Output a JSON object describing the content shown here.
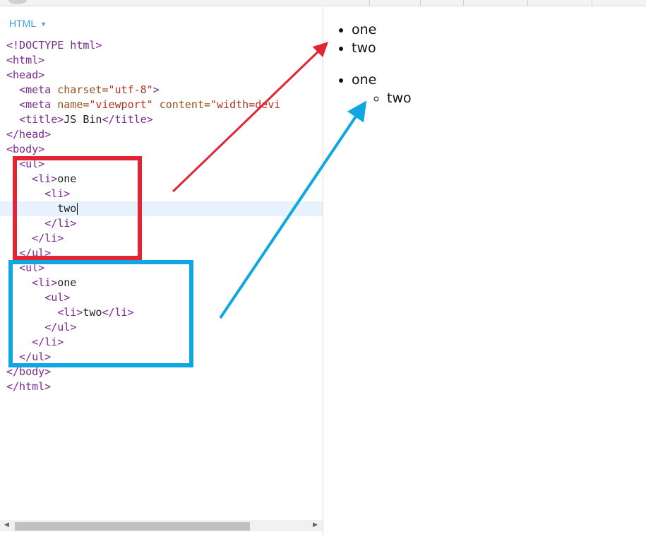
{
  "editor": {
    "language_label": "HTML",
    "code_lines": [
      {
        "indent": "",
        "parts": [
          {
            "c": "kw",
            "t": "<!DOCTYPE html>"
          }
        ]
      },
      {
        "indent": "",
        "parts": [
          {
            "c": "tag",
            "t": "<html>"
          }
        ]
      },
      {
        "indent": "",
        "parts": [
          {
            "c": "tag",
            "t": "<head>"
          }
        ]
      },
      {
        "indent": "  ",
        "parts": [
          {
            "c": "tag",
            "t": "<meta "
          },
          {
            "c": "attr",
            "t": "charset="
          },
          {
            "c": "str",
            "t": "\"utf-8\""
          },
          {
            "c": "tag",
            "t": ">"
          }
        ]
      },
      {
        "indent": "  ",
        "parts": [
          {
            "c": "tag",
            "t": "<meta "
          },
          {
            "c": "attr",
            "t": "name="
          },
          {
            "c": "str",
            "t": "\"viewport\""
          },
          {
            "c": "attr",
            "t": " content="
          },
          {
            "c": "str",
            "t": "\"width=devi"
          }
        ]
      },
      {
        "indent": "  ",
        "parts": [
          {
            "c": "tag",
            "t": "<title>"
          },
          {
            "c": "txt",
            "t": "JS Bin"
          },
          {
            "c": "tag",
            "t": "</title>"
          }
        ]
      },
      {
        "indent": "",
        "parts": [
          {
            "c": "tag",
            "t": "</head>"
          }
        ]
      },
      {
        "indent": "",
        "parts": [
          {
            "c": "tag",
            "t": "<body>"
          }
        ]
      },
      {
        "indent": "  ",
        "parts": [
          {
            "c": "tag",
            "t": "<ul>"
          }
        ]
      },
      {
        "indent": "    ",
        "parts": [
          {
            "c": "tag",
            "t": "<li>"
          },
          {
            "c": "txt",
            "t": "one"
          }
        ]
      },
      {
        "indent": "      ",
        "parts": [
          {
            "c": "tag",
            "t": "<li>"
          }
        ]
      },
      {
        "indent": "        ",
        "parts": [
          {
            "c": "txt",
            "t": "two"
          }
        ],
        "active": true,
        "cursor": true
      },
      {
        "indent": "      ",
        "parts": [
          {
            "c": "tag",
            "t": "</li>"
          }
        ]
      },
      {
        "indent": "    ",
        "parts": [
          {
            "c": "tag",
            "t": "</li>"
          }
        ]
      },
      {
        "indent": "  ",
        "parts": [
          {
            "c": "tag",
            "t": "</ul>"
          }
        ]
      },
      {
        "indent": "  ",
        "parts": [
          {
            "c": "tag",
            "t": "<ul>"
          }
        ]
      },
      {
        "indent": "    ",
        "parts": [
          {
            "c": "tag",
            "t": "<li>"
          },
          {
            "c": "txt",
            "t": "one"
          }
        ]
      },
      {
        "indent": "      ",
        "parts": [
          {
            "c": "tag",
            "t": "<ul>"
          }
        ]
      },
      {
        "indent": "        ",
        "parts": [
          {
            "c": "tag",
            "t": "<li>"
          },
          {
            "c": "txt",
            "t": "two"
          },
          {
            "c": "tag",
            "t": "</li>"
          }
        ]
      },
      {
        "indent": "      ",
        "parts": [
          {
            "c": "tag",
            "t": "</ul>"
          }
        ]
      },
      {
        "indent": "    ",
        "parts": [
          {
            "c": "tag",
            "t": "</li>"
          }
        ]
      },
      {
        "indent": "  ",
        "parts": [
          {
            "c": "tag",
            "t": "</ul>"
          }
        ]
      },
      {
        "indent": "",
        "parts": [
          {
            "c": "tag",
            "t": "</body>"
          }
        ]
      },
      {
        "indent": "",
        "parts": [
          {
            "c": "tag",
            "t": "</html>"
          }
        ]
      }
    ]
  },
  "preview": {
    "list1": [
      "one",
      "two"
    ],
    "list2": {
      "item": "one",
      "nested": [
        "two"
      ]
    }
  },
  "annotations": {
    "red": "#e32434",
    "blue": "#0ea7e2"
  },
  "colors": {
    "tag": "#7b2a8f",
    "attr": "#9a4e1a",
    "string": "#b0321f",
    "active_line": "#e8f2fe",
    "lang_label": "#3ba2e0"
  }
}
